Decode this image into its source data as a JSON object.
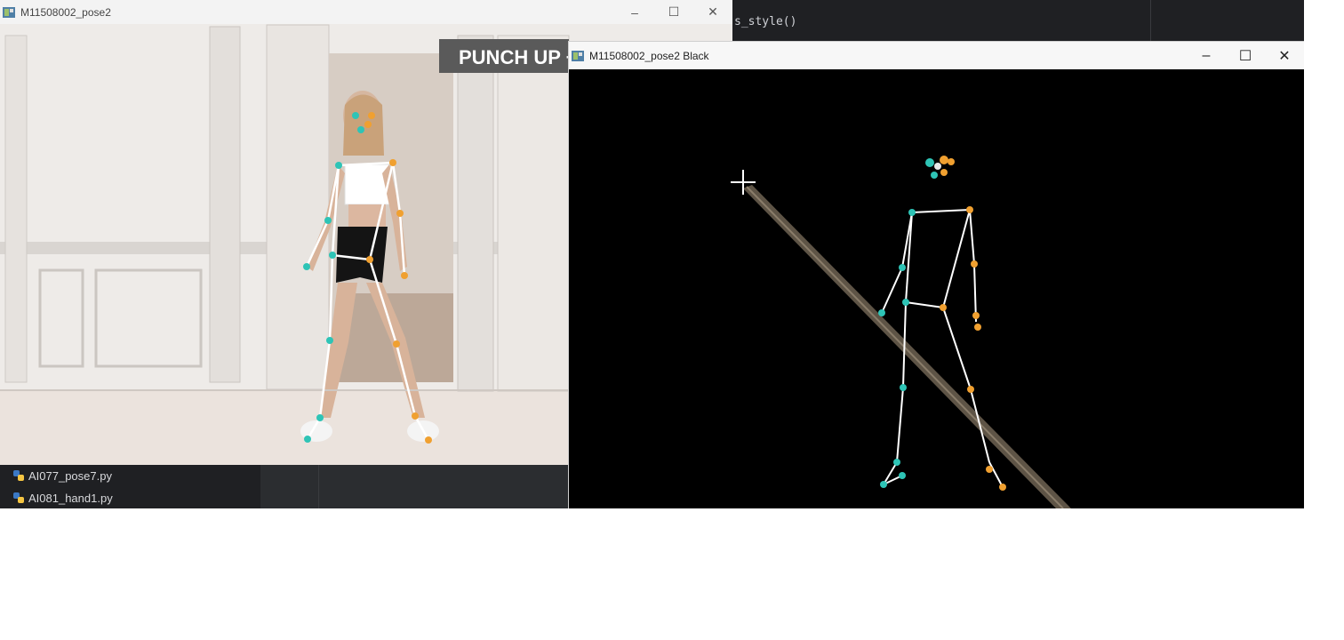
{
  "window_main": {
    "title": "M11508002_pose2",
    "overlay_text": "PUNCH UP + D",
    "controls": {
      "minimize": "–",
      "maximize": "☐",
      "close": "✕"
    }
  },
  "window_black": {
    "title": "M11508002_pose2 Black",
    "controls": {
      "minimize": "–",
      "maximize": "☐",
      "close": "✕"
    }
  },
  "editor": {
    "code_line": "s_style()"
  },
  "project_files": [
    {
      "name": "AI077_pose7.py",
      "icon": "python-file-icon"
    },
    {
      "name": "AI081_hand1.py",
      "icon": "python-file-icon"
    }
  ],
  "colors": {
    "left_joint": "#2ec4b6",
    "right_joint": "#f0a030",
    "skeleton_line": "#ffffff",
    "overlay_bg": "#5a5a5a"
  }
}
